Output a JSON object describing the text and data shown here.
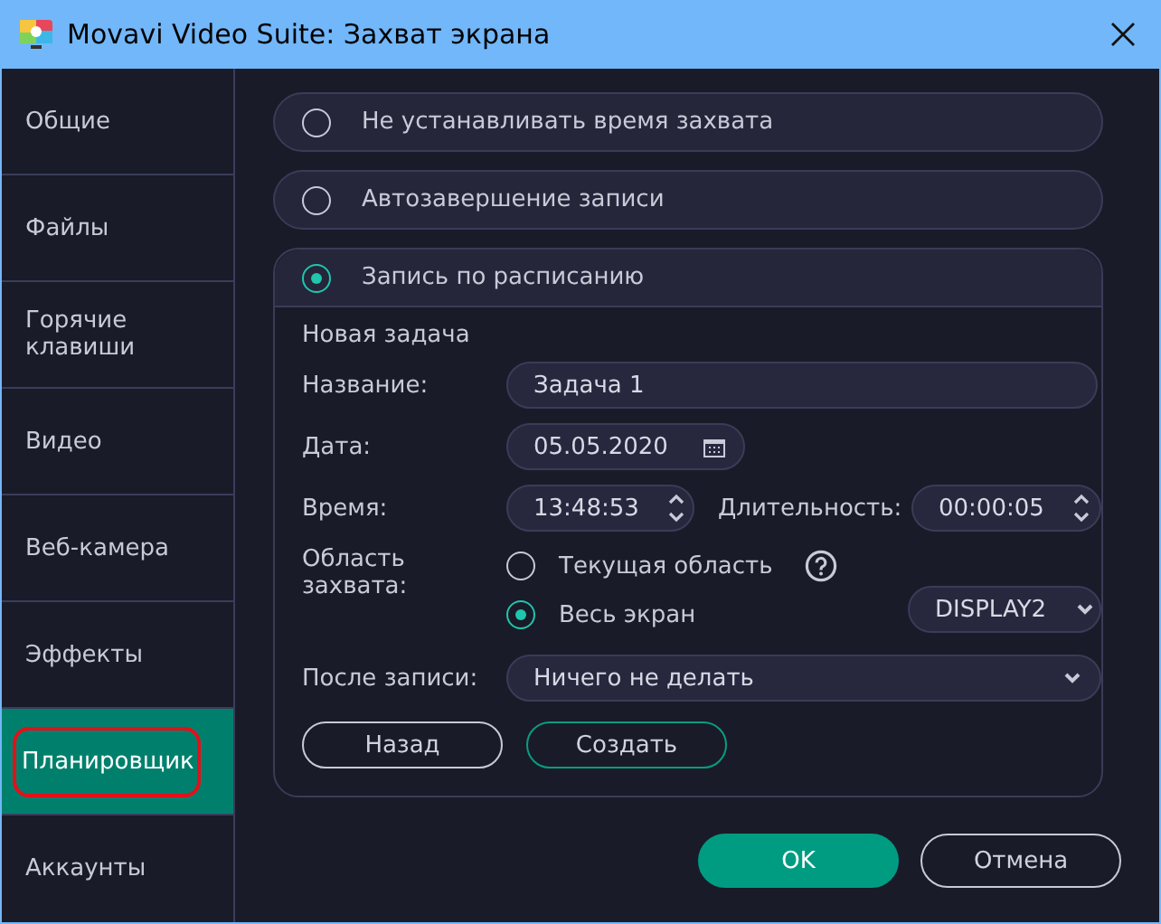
{
  "window": {
    "title": "Movavi Video Suite: Захват экрана"
  },
  "sidebar": {
    "items": [
      {
        "label": "Общие",
        "selected": false,
        "annotated": false
      },
      {
        "label": "Файлы",
        "selected": false,
        "annotated": false
      },
      {
        "label": "Горячие клавиши",
        "selected": false,
        "annotated": false
      },
      {
        "label": "Видео",
        "selected": false,
        "annotated": false
      },
      {
        "label": "Веб-камера",
        "selected": false,
        "annotated": false
      },
      {
        "label": "Эффекты",
        "selected": false,
        "annotated": false
      },
      {
        "label": "Планировщик",
        "selected": true,
        "annotated": true
      },
      {
        "label": "Аккаунты",
        "selected": false,
        "annotated": false
      }
    ]
  },
  "capture_modes": [
    {
      "label": "Не устанавливать время захвата",
      "selected": false,
      "kind": "bar"
    },
    {
      "label": "Автозавершение записи",
      "selected": false,
      "kind": "bar"
    },
    {
      "label": "Запись по расписанию",
      "selected": true,
      "kind": "panel"
    }
  ],
  "schedule": {
    "heading": "Новая задача",
    "name_label": "Название:",
    "name_value": "Задача 1",
    "date_label": "Дата:",
    "date_value": "05.05.2020",
    "time_label": "Время:",
    "time_value": "13:48:53",
    "duration_label": "Длительность:",
    "duration_value": "00:00:05",
    "area_label": "Область захвата:",
    "area_options": [
      {
        "label": "Текущая область",
        "selected": false,
        "help": true
      },
      {
        "label": "Весь экран",
        "selected": true,
        "help": false
      }
    ],
    "display": "DISPLAY2",
    "after_label": "После записи:",
    "after_value": "Ничего не делать",
    "buttons": [
      {
        "label": "Назад",
        "kind": "plain"
      },
      {
        "label": "Создать",
        "kind": "accent"
      }
    ]
  },
  "buttons": [
    {
      "label": "OK",
      "kind": "primary"
    },
    {
      "label": "Отмена",
      "kind": "plain"
    }
  ]
}
